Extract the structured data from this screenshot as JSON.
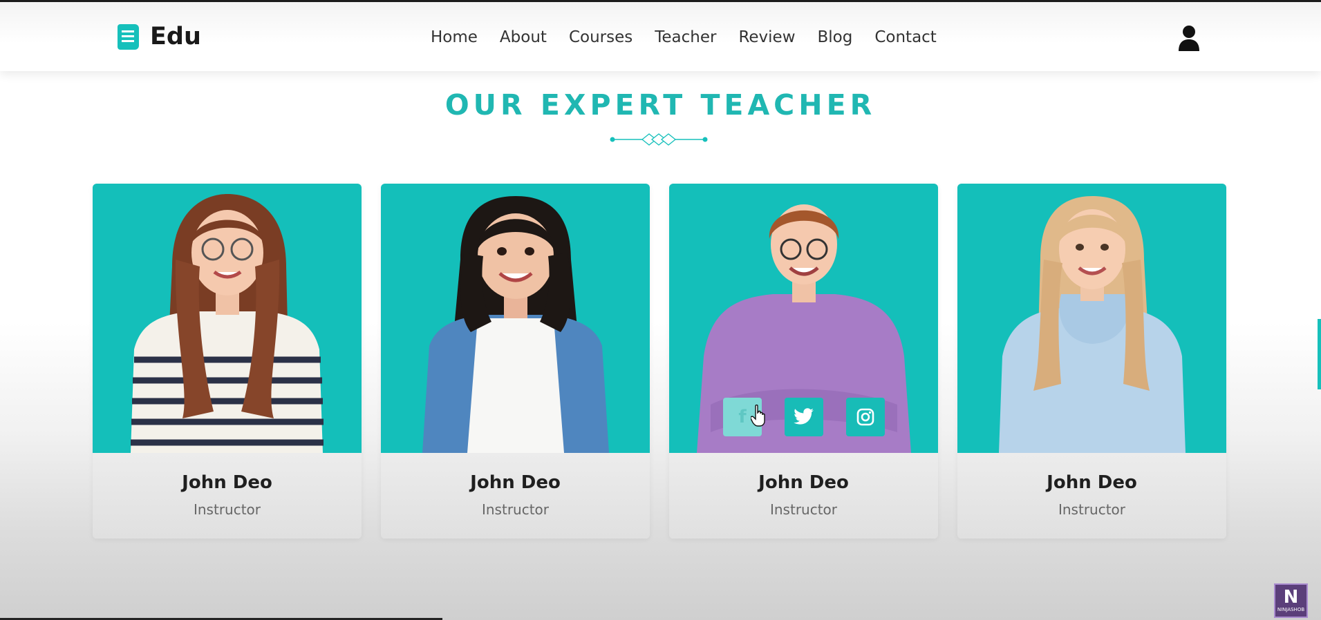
{
  "brand": {
    "name": "Edu",
    "icon": "book-icon"
  },
  "nav": {
    "items": [
      "Home",
      "About",
      "Courses",
      "Teacher",
      "Review",
      "Blog",
      "Contact"
    ],
    "user_icon": "user-icon"
  },
  "section": {
    "title": "OUR EXPERT TEACHER"
  },
  "teachers": [
    {
      "name": "John Deo",
      "role": "Instructor"
    },
    {
      "name": "John Deo",
      "role": "Instructor"
    },
    {
      "name": "John Deo",
      "role": "Instructor",
      "socials": [
        "facebook-icon",
        "twitter-icon",
        "instagram-icon"
      ]
    },
    {
      "name": "John Deo",
      "role": "Instructor"
    }
  ],
  "colors": {
    "accent": "#16c0bb",
    "text": "#1f1f1f"
  },
  "watermark": {
    "label": "NINJASHOB"
  }
}
